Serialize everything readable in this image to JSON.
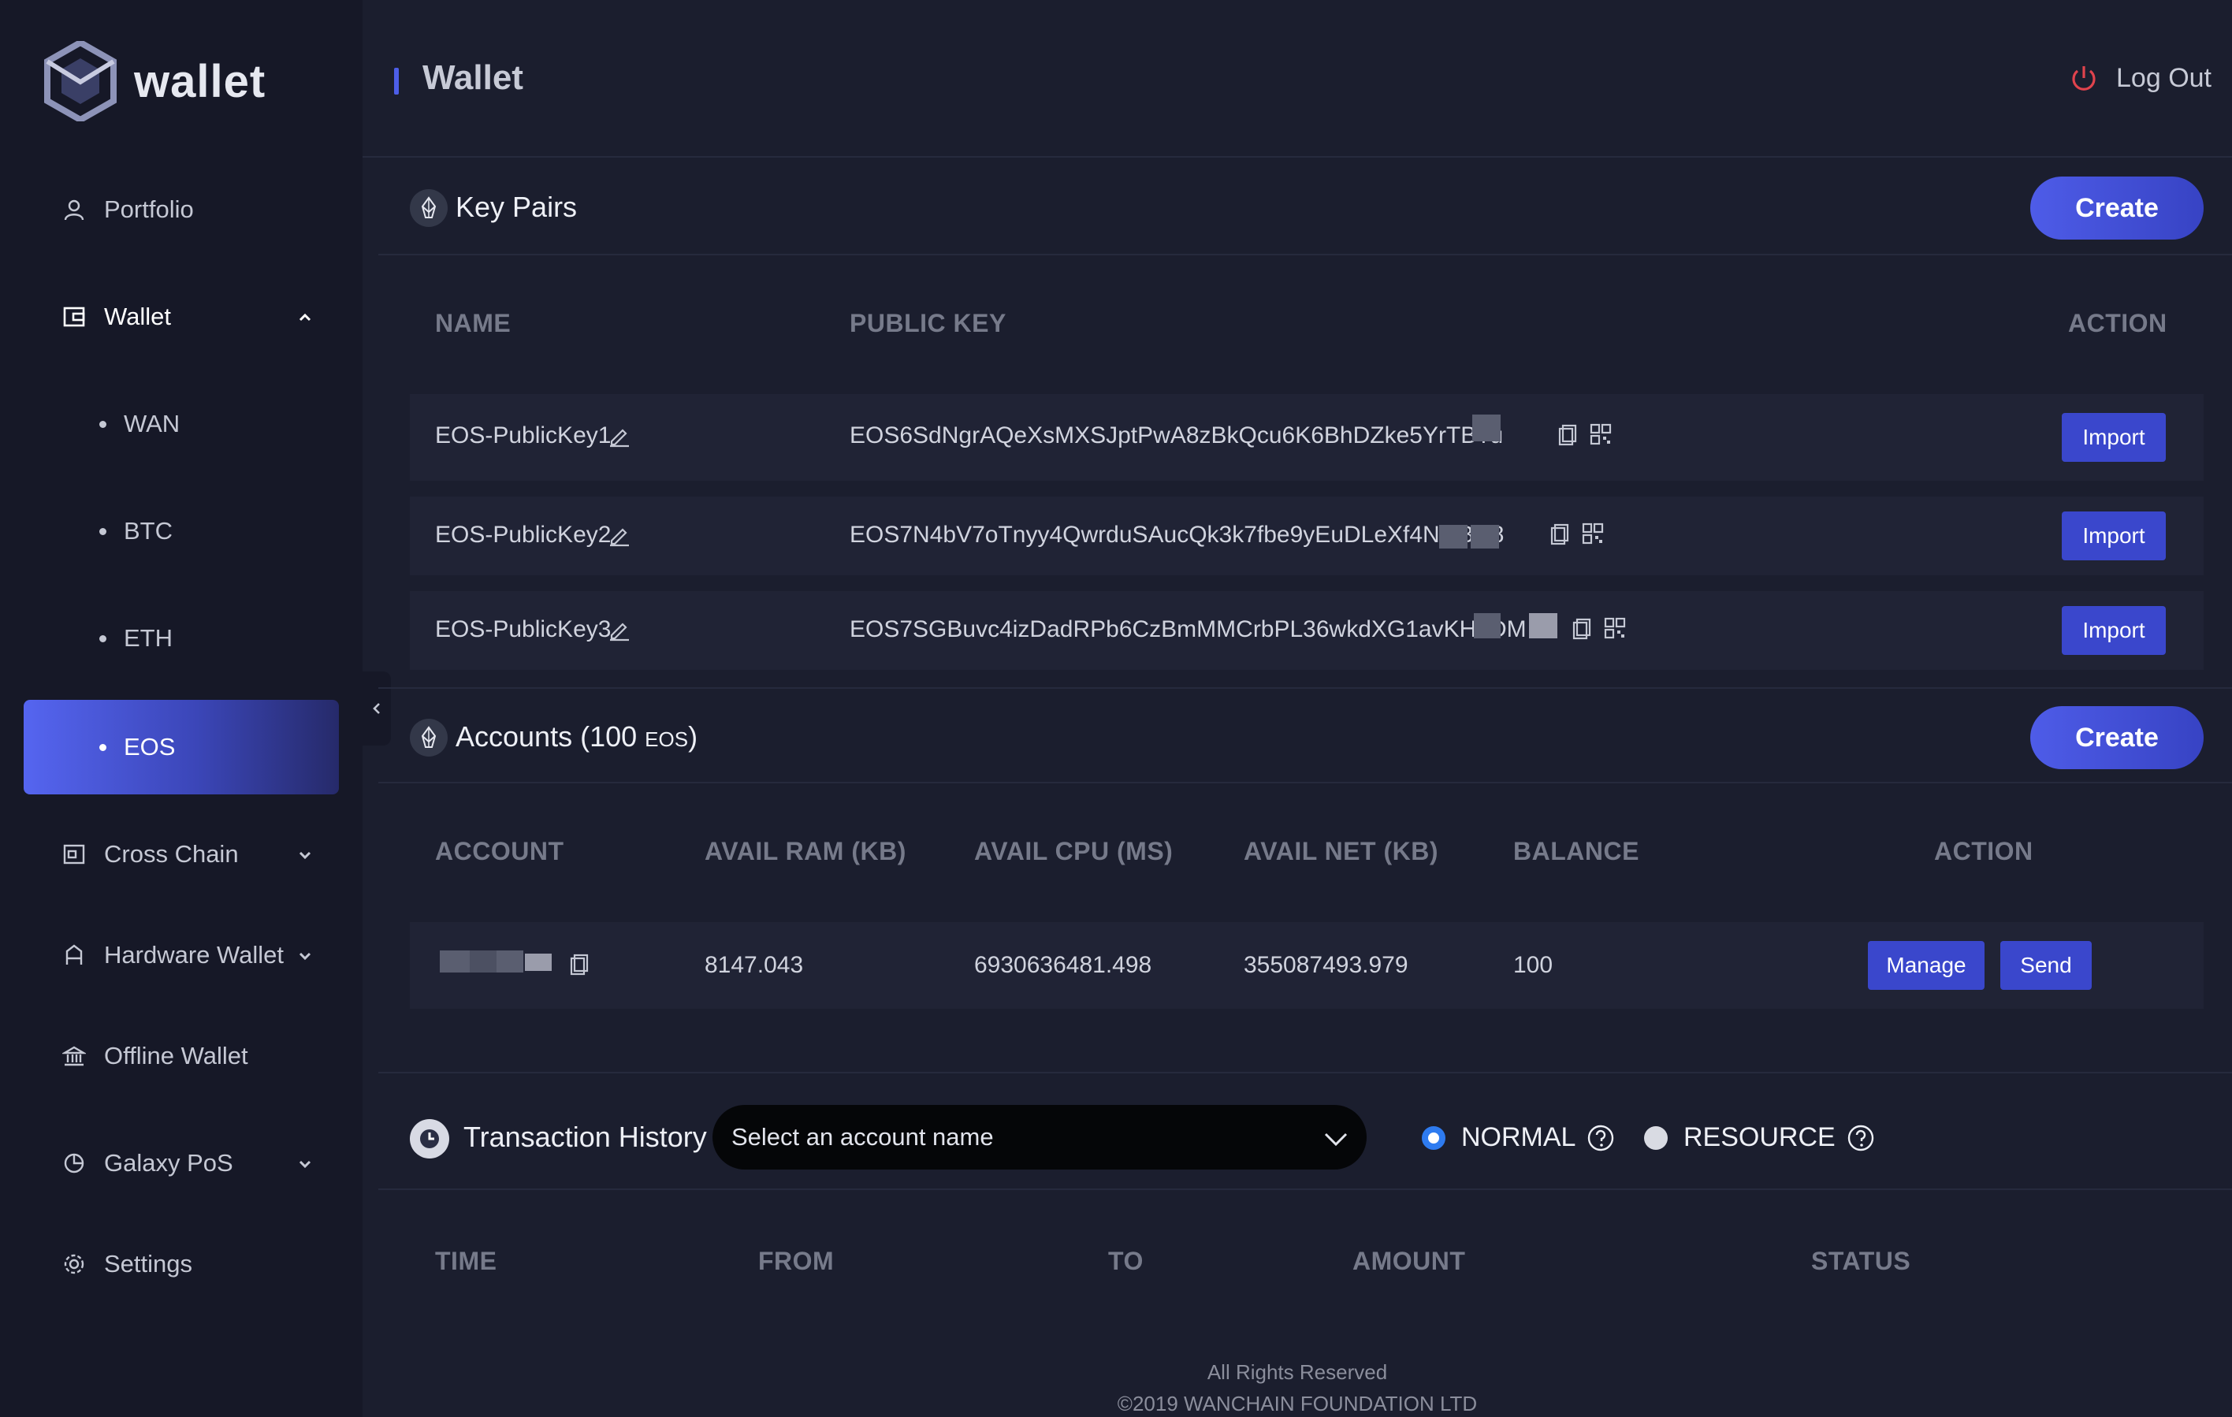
{
  "app": {
    "logo_text": "wallet"
  },
  "sidebar": {
    "items": [
      {
        "label": "Portfolio",
        "icon": "user-icon"
      },
      {
        "label": "Wallet",
        "icon": "wallet-icon",
        "expanded": true
      },
      {
        "label": "WAN"
      },
      {
        "label": "BTC"
      },
      {
        "label": "ETH"
      },
      {
        "label": "EOS",
        "active": true
      },
      {
        "label": "Cross Chain",
        "icon": "cross-chain-icon"
      },
      {
        "label": "Hardware Wallet",
        "icon": "hardware-wallet-icon"
      },
      {
        "label": "Offline Wallet",
        "icon": "bank-icon"
      },
      {
        "label": "Galaxy PoS",
        "icon": "pie-chart-icon"
      },
      {
        "label": "Settings",
        "icon": "gear-icon"
      }
    ]
  },
  "header": {
    "title": "Wallet",
    "logout_label": "Log Out"
  },
  "keypairs": {
    "title": "Key Pairs",
    "create_label": "Create",
    "columns": {
      "name": "NAME",
      "public_key": "PUBLIC KEY",
      "action": "ACTION"
    },
    "rows": [
      {
        "name": "EOS-PublicKey1",
        "public_key": "EOS6SdNgrAQeXsMXSJptPwA8zBkQcu6K6BhDZke5YrTBTu",
        "action": "Import"
      },
      {
        "name": "EOS-PublicKey2",
        "public_key": "EOS7N4bV7oTnyy4QwrduSAucQk3k7fbe9yEuDLeXf4NGBD8",
        "action": "Import"
      },
      {
        "name": "EOS-PublicKey3",
        "public_key": "EOS7SGBuvc4izDadRPb6CzBmMMCrbPL36wkdXG1avKH8DM",
        "action": "Import"
      }
    ]
  },
  "accounts": {
    "title": "Accounts (100 ",
    "title_unit": "EOS",
    "title_close": ")",
    "create_label": "Create",
    "columns": {
      "account": "ACCOUNT",
      "ram": "AVAIL RAM (KB)",
      "cpu": "AVAIL CPU (MS)",
      "net": "AVAIL NET (KB)",
      "balance": "BALANCE",
      "action": "ACTION"
    },
    "rows": [
      {
        "ram": "8147.043",
        "cpu": "6930636481.498",
        "net": "355087493.979",
        "balance": "100",
        "manage": "Manage",
        "send": "Send"
      }
    ]
  },
  "history": {
    "title": "Transaction History",
    "select_placeholder": "Select an account name",
    "radio_normal": "NORMAL",
    "radio_resource": "RESOURCE",
    "selected": "NORMAL",
    "columns": {
      "time": "TIME",
      "from": "FROM",
      "to": "TO",
      "amount": "AMOUNT",
      "status": "STATUS"
    }
  },
  "footer": {
    "line1": "All Rights Reserved",
    "line2": "©2019 WANCHAIN FOUNDATION LTD"
  },
  "colors": {
    "accent": "#4d5ee8",
    "button": "#3a47cc",
    "sidebar_bg": "#161827",
    "main_bg": "#1b1e2e",
    "logout_red": "#e0434d"
  }
}
